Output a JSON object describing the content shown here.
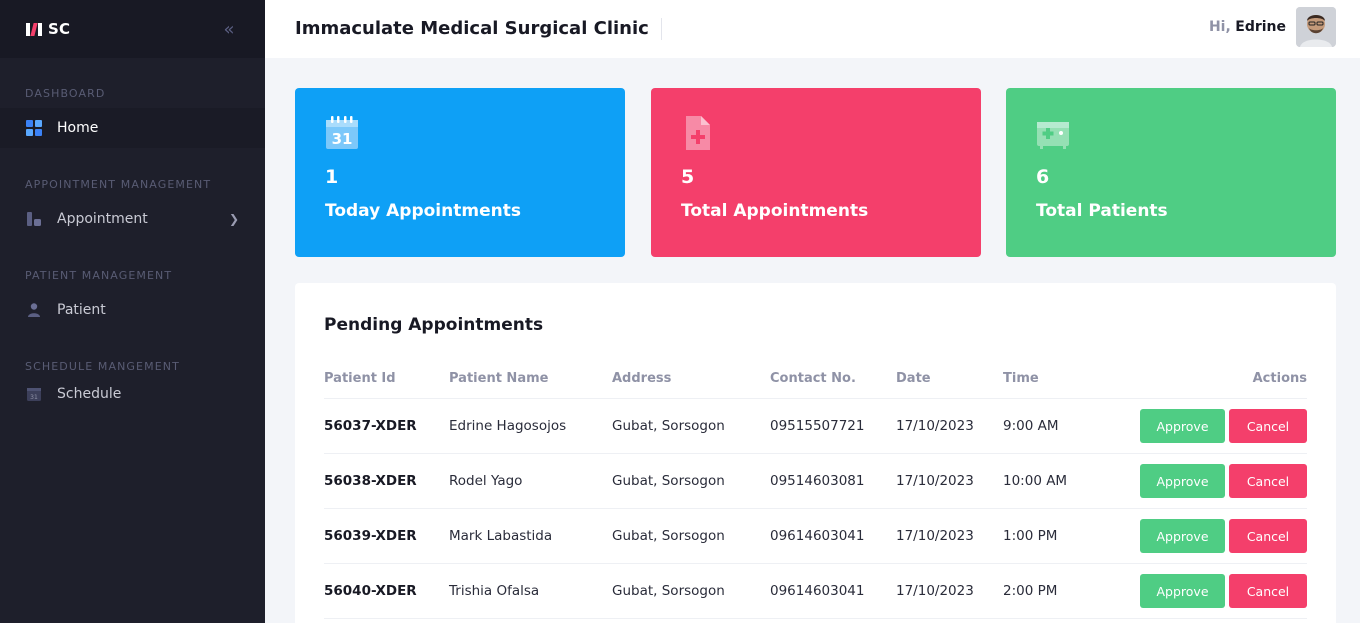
{
  "sidebar": {
    "logo": "SC",
    "sections": [
      {
        "label": "DASHBOARD",
        "item": "Home"
      },
      {
        "label": "APPOINTMENT MANAGEMENT",
        "item": "Appointment"
      },
      {
        "label": "PATIENT MANAGEMENT",
        "item": "Patient"
      },
      {
        "label": "SCHEDULE MANGEMENT",
        "item": "Schedule"
      }
    ]
  },
  "header": {
    "title": "Immaculate Medical Surgical Clinic",
    "greeting": "Hi,",
    "user_name": "Edrine"
  },
  "cards": [
    {
      "value": "1",
      "label": "Today Appointments",
      "icon": "calendar-icon",
      "color": "#0ea0f6"
    },
    {
      "value": "5",
      "label": "Total Appointments",
      "icon": "medical-file-icon",
      "color": "#f43f6b"
    },
    {
      "value": "6",
      "label": "Total Patients",
      "icon": "medical-kit-icon",
      "color": "#4fcd84"
    }
  ],
  "pending": {
    "title": "Pending Appointments",
    "columns": [
      "Patient Id",
      "Patient Name",
      "Address",
      "Contact No.",
      "Date",
      "Time",
      "Actions"
    ],
    "rows": [
      {
        "id": "56037-XDER",
        "name": "Edrine Hagosojos",
        "address": "Gubat, Sorsogon",
        "contact": "09515507721",
        "date": "17/10/2023",
        "time": "9:00 AM"
      },
      {
        "id": "56038-XDER",
        "name": "Rodel Yago",
        "address": "Gubat, Sorsogon",
        "contact": "09514603081",
        "date": "17/10/2023",
        "time": "10:00 AM"
      },
      {
        "id": "56039-XDER",
        "name": "Mark Labastida",
        "address": "Gubat, Sorsogon",
        "contact": "09614603041",
        "date": "17/10/2023",
        "time": "1:00 PM"
      },
      {
        "id": "56040-XDER",
        "name": "Trishia Ofalsa",
        "address": "Gubat, Sorsogon",
        "contact": "09614603041",
        "date": "17/10/2023",
        "time": "2:00 PM"
      }
    ],
    "approve_label": "Approve",
    "cancel_label": "Cancel"
  }
}
